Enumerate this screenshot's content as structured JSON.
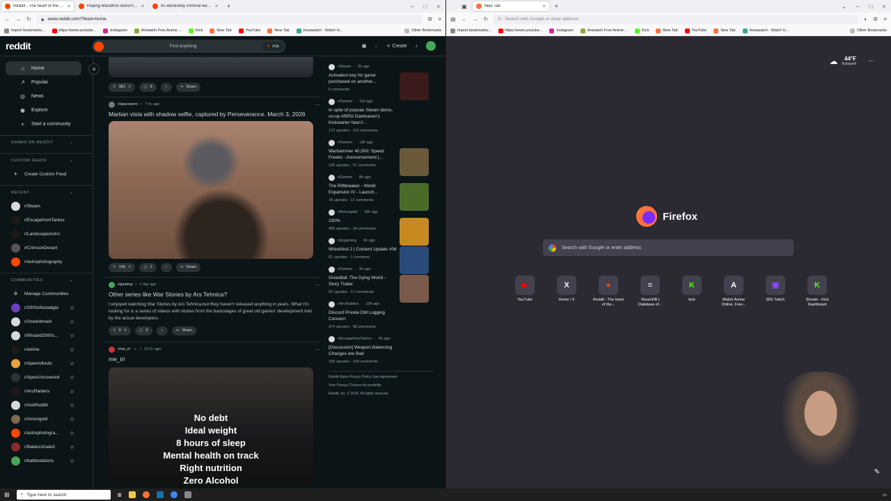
{
  "left_window": {
    "tabs": [
      {
        "title": "Reddit - The heart of the intern",
        "active": true
      },
      {
        "title": "Hoping Marathon doesn't flop",
        "active": false
      },
      {
        "title": "Its absolutely criminal we neve",
        "active": false
      }
    ],
    "url": "www.reddit.com/?feed=home",
    "bookmarks": [
      "Import bookmarks...",
      "https://www.youtube...",
      "Instagram",
      "Aniwatch Free Anime ...",
      "Kick",
      "New Tab",
      "YouTube",
      "New Tab",
      "Hurawatch - Watch H..."
    ],
    "other_bookmarks": "Other Bookmarks"
  },
  "right_window": {
    "tabs": [
      {
        "title": "New Tab",
        "active": true
      }
    ],
    "url_placeholder": "Search with Google or enter address",
    "bookmarks": [
      "Import bookmarks...",
      "https://www.youtube...",
      "Instagram",
      "Aniwatch Free Anime ...",
      "Kick",
      "New Tab",
      "YouTube",
      "New Tab",
      "Hurawatch - Watch H..."
    ],
    "other_bookmarks": "Other Bookmarks"
  },
  "reddit": {
    "logo": "reddit",
    "search_placeholder": "Find anything",
    "ask_label": "Ask",
    "create_label": "Create",
    "nav": [
      {
        "icon": "⌂",
        "label": "Home"
      },
      {
        "icon": "↗",
        "label": "Popular"
      },
      {
        "icon": "◎",
        "label": "News"
      },
      {
        "icon": "◉",
        "label": "Explore"
      },
      {
        "icon": "+",
        "label": "Start a community"
      }
    ],
    "sections": {
      "games": "GAMES ON REDDIT",
      "custom_feeds": "CUSTOM FEEDS",
      "create_custom_feed": "Create Custom Feed",
      "recent": "RECENT",
      "communities": "COMMUNITIES",
      "manage_communities": "Manage Communities"
    },
    "recent": [
      {
        "name": "r/Steam",
        "color": "#d7dadc"
      },
      {
        "name": "r/EscapefromTarkov",
        "color": "#1a1a1a"
      },
      {
        "name": "r/LandscapeAstro",
        "color": "#1a1a1a"
      },
      {
        "name": "r/CrimsonDesert",
        "color": "#555555"
      },
      {
        "name": "r/astrophotography",
        "color": "#ff4500"
      }
    ],
    "communities": [
      {
        "name": "r/2000sNostalgia",
        "color": "#6d3fc0"
      },
      {
        "name": "r/2meirl4meirl",
        "color": "#d7dadc"
      },
      {
        "name": "r/90sand2000s...",
        "color": "#d7dadc"
      },
      {
        "name": "r/anime",
        "color": "#1a1a1a"
      },
      {
        "name": "r/Apexrollouts",
        "color": "#e8a33d"
      },
      {
        "name": "r/ApexUncovered",
        "color": "#2a3236"
      },
      {
        "name": "r/ArcRaiders",
        "color": "#1a1a1a"
      },
      {
        "name": "r/AskReddit",
        "color": "#d7dadc"
      },
      {
        "name": "r/Amongold",
        "color": "#7a6a50"
      },
      {
        "name": "r/astrophotogra...",
        "color": "#ff4500"
      },
      {
        "name": "r/BaldursGate3",
        "color": "#8a2a2a"
      },
      {
        "name": "r/battlestations",
        "color": "#46a758"
      }
    ],
    "top_post_actions": {
      "votes": "381",
      "comments": "8",
      "share": "Share"
    },
    "post1": {
      "sub": "r/spaceporn",
      "time": "7 hr. ago",
      "title": "Martian vista with shadow selfie, captured by Perseverance. March 3, 2026",
      "votes": "108",
      "comments": "2",
      "share": "Share"
    },
    "post2": {
      "sub": "r/gaming",
      "time": "1 day ago",
      "title": "Other series like War Stories by Ars Tehnica?",
      "body": "I enjoyed watching War Stories by Ars Tehnica but they haven't released anything in years. What I'm looking for is a series of videos with stories from the backstages of great old games' development told by the actual developers.",
      "votes": "9",
      "comments": "5",
      "share": "Share"
    },
    "post3": {
      "sub": "r/me_irl",
      "time": "12 hr. ago",
      "title": "me_irl",
      "meme_lines": [
        "No debt",
        "Ideal weight",
        "8 hours of sleep",
        "Mental health on track",
        "Right nutrition",
        "Zero Alcohol"
      ]
    },
    "recent_posts": [
      {
        "sub": "r/Steam",
        "time": "2h ago",
        "title": "Activation key for game purchased on another...",
        "stats": "5 comments",
        "thumb": "#3a1a1a"
      },
      {
        "sub": "r/Games",
        "time": "11h ago",
        "title": "In spite of popular Steam demo, co-op ARPG Darkhaven's Kickstarter hasn't...",
        "stats": "172 upvotes · 110 comments",
        "thumb": ""
      },
      {
        "sub": "r/Games",
        "time": "13h ago",
        "title": "Warhammer 40,000: Speed Freeks - Announcement |...",
        "stats": "126 upvotes · 57 comments",
        "thumb": "#6a5a3a"
      },
      {
        "sub": "r/Games",
        "time": "8h ago",
        "title": "The Riftbreaker - World Expansion IV - Launch...",
        "stats": "78 upvotes · 17 comments",
        "thumb": "#4a6a2a"
      },
      {
        "sub": "r/Amongold",
        "time": "18h ago",
        "title": "100%",
        "stats": "465 upvotes · 24 comments",
        "thumb": "#c88a20"
      },
      {
        "sub": "r/pcgaming",
        "time": "6h ago",
        "title": "Wreckfest 2 | Content Update #06",
        "stats": "61 upvotes · 1 comment",
        "thumb": "#2a4a7a"
      },
      {
        "sub": "r/Games",
        "time": "9h ago",
        "title": "Greedfall: The Dying World - Story Trailer",
        "stats": "52 upvotes · 17 comments",
        "thumb": "#7a5a4a"
      },
      {
        "sub": "r/ArcRaiders",
        "time": "10h ago",
        "title": "Discord Private DM Logging Concern",
        "stats": "374 upvotes · 58 comments",
        "thumb": ""
      },
      {
        "sub": "r/EscapefromTarkov",
        "time": "9h ago",
        "title": "[Discussion] Weapon Balancing Changes are Bad",
        "stats": "159 upvotes · 149 comments",
        "thumb": ""
      }
    ],
    "footer": [
      "Reddit Rules  Privacy Policy  User Agreement",
      "Your Privacy Choices  Accessibility",
      "Reddit, Inc. © 2026. All rights reserved."
    ]
  },
  "firefox": {
    "weather_temp": "44°F",
    "weather_city": "Kalispell",
    "brand": "Firefox",
    "search_placeholder": "Search with Google or enter address",
    "shortcuts": [
      {
        "label": "YouTube",
        "glyph": "▶",
        "color": "#ff0000"
      },
      {
        "label": "Home / X",
        "glyph": "X",
        "color": "#fbfbfe"
      },
      {
        "label": "Reddit - The heart of the...",
        "glyph": "●",
        "color": "#ff4500"
      },
      {
        "label": "SteamDB | Database of...",
        "glyph": "≡",
        "color": "#fbfbfe"
      },
      {
        "label": "kick",
        "glyph": "K",
        "color": "#53fc18"
      },
      {
        "label": "Watch Anime Online, Free...",
        "glyph": "A",
        "color": "#fbfbfe"
      },
      {
        "label": "(60) Twitch",
        "glyph": "▣",
        "color": "#9146ff"
      },
      {
        "label": "Stream - Kick Dashboard",
        "glyph": "K",
        "color": "#53fc18"
      }
    ]
  },
  "taskbar": {
    "search_placeholder": "Type here to search"
  }
}
